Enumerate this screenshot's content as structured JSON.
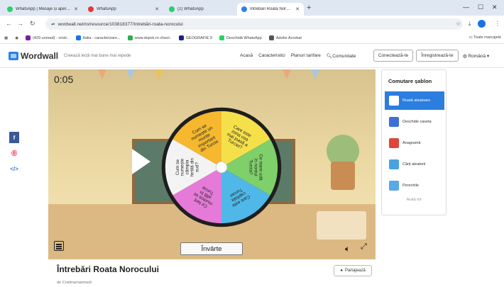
{
  "browser": {
    "tabs": [
      {
        "label": "WhatsApp | Mesaje și apeluri ș",
        "color": "#25d366"
      },
      {
        "label": "WhatsApp",
        "color": "#e53935"
      },
      {
        "label": "(2) WhatsApp",
        "color": "#25d366"
      },
      {
        "label": "Întrebări Roata Norocului - Roa",
        "color": "#2f80ed"
      }
    ],
    "url": "wordwall.net/ro/resource/103818377/întrebări-roata-norocului",
    "bookmarks": [
      {
        "label": "(429 unread) - cristi..",
        "color": "#7b1fa2"
      },
      {
        "label": "Italia - caracterizare...",
        "color": "#1a73e8"
      },
      {
        "label": "www.dspcb.ro cheol..",
        "color": "#34a853"
      },
      {
        "label": "GEOGRAFIE 9",
        "color": "#1a237e"
      },
      {
        "label": "Deschidă WhatsApp",
        "color": "#25d366"
      },
      {
        "label": "Adobe Acrobat",
        "color": "#555555"
      }
    ],
    "all_bookmarks": "Toate marcajele"
  },
  "site": {
    "logo_text": "Wordwall",
    "tagline": "Creează lecții mai bune mai repede",
    "nav": [
      "Acasă",
      "Caracteristici",
      "Planuri tarifare",
      "Comunitate"
    ],
    "login": "Conectează-te",
    "signup": "Înregistrează-te",
    "language": "Română"
  },
  "game": {
    "timer": "0:05",
    "spin_label": "Învârte",
    "segments": [
      {
        "text": "Cum se numește un munte important din Turcia",
        "color": "#f5b82e"
      },
      {
        "text": "Care este zona cea mai joasă a Turciei?",
        "color": "#f6e04a"
      },
      {
        "text": "Ce mare udă în nordul Turcia?",
        "color": "#7fd06a"
      },
      {
        "text": "Care este capitala Turciei",
        "color": "#4fb8e8"
      },
      {
        "text": "Ce lanț muntos se află în Turcia",
        "color": "#e57ad8"
      },
      {
        "text": "Cum se numește câmpia fertilă din sud?",
        "color": "#f3f3f3"
      }
    ]
  },
  "switcher": {
    "title": "Comutare șablon",
    "items": [
      {
        "label": "Roată aleatoare",
        "color": "#2b7de0"
      },
      {
        "label": "Deschide caseta",
        "color": "#3d6fd6"
      },
      {
        "label": "Anagramă",
        "color": "#e0443a"
      },
      {
        "label": "Cărți aleatorii",
        "color": "#4aa3df"
      },
      {
        "label": "Perechile",
        "color": "#5aa8e6"
      }
    ],
    "show_more": "Arată tot"
  },
  "activity": {
    "title": "Întrebări Roata Norocului",
    "author": "de Cristinamarimedi",
    "share": "Partajează"
  }
}
